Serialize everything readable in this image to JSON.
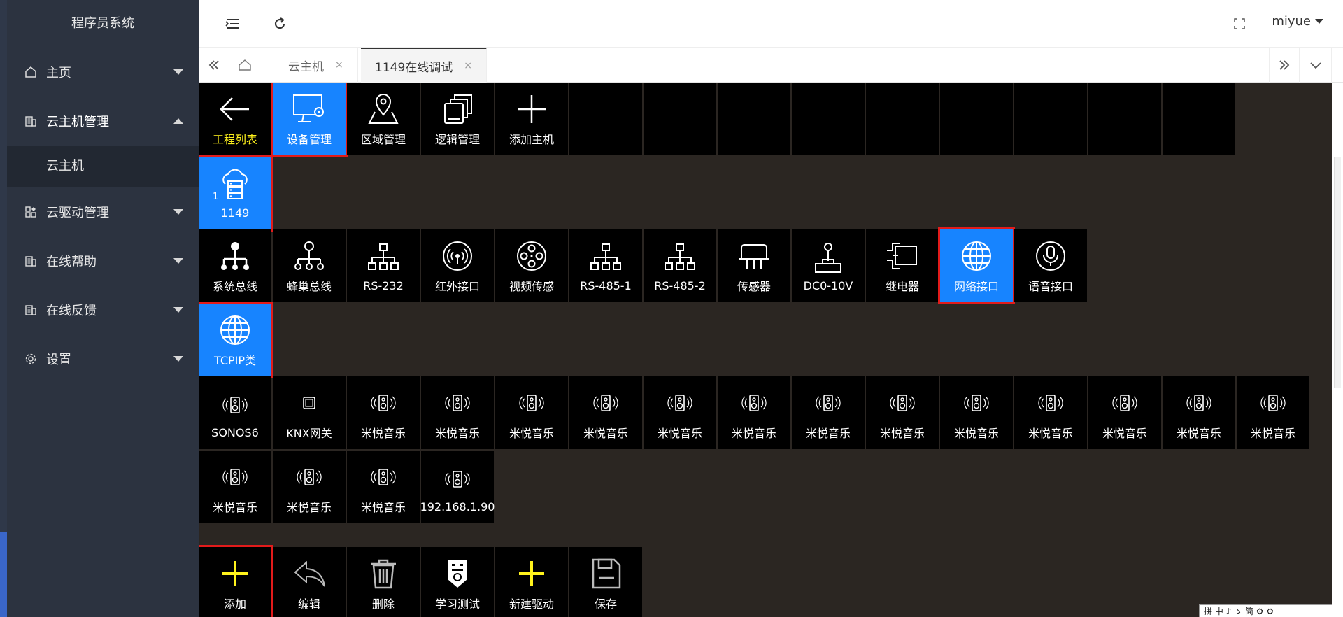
{
  "app": {
    "title": "程序员系统"
  },
  "sidebar": {
    "items": [
      {
        "label": "主页",
        "icon": "home-icon",
        "arrow": "down"
      },
      {
        "label": "云主机管理",
        "icon": "building-icon",
        "arrow": "up",
        "children": [
          {
            "label": "云主机"
          }
        ]
      },
      {
        "label": "云驱动管理",
        "icon": "apps-icon",
        "arrow": "down"
      },
      {
        "label": "在线帮助",
        "icon": "building-icon",
        "arrow": "down"
      },
      {
        "label": "在线反馈",
        "icon": "building-icon",
        "arrow": "down"
      },
      {
        "label": "设置",
        "icon": "gear-icon",
        "arrow": "down"
      }
    ]
  },
  "header": {
    "user": "miyue"
  },
  "tabs": [
    {
      "label": "云主机",
      "close": "×"
    },
    {
      "label": "1149在线调试",
      "close": "×"
    }
  ],
  "toolbar": [
    {
      "label": "工程列表",
      "icon": "arrow-left-icon"
    },
    {
      "label": "设备管理",
      "icon": "monitor-gear-icon"
    },
    {
      "label": "区域管理",
      "icon": "map-pin-icon"
    },
    {
      "label": "逻辑管理",
      "icon": "copy-icon"
    },
    {
      "label": "添加主机",
      "icon": "plus-icon"
    }
  ],
  "host": {
    "label": "1149",
    "index": "1"
  },
  "interfaces": [
    {
      "label": "系统总线",
      "icon": "bus-icon"
    },
    {
      "label": "蜂巢总线",
      "icon": "network-tree-icon"
    },
    {
      "label": "RS-232",
      "icon": "hierarchy-icon"
    },
    {
      "label": "红外接口",
      "icon": "infrared-icon"
    },
    {
      "label": "视频传感",
      "icon": "film-reel-icon"
    },
    {
      "label": "RS-485-1",
      "icon": "hierarchy-icon"
    },
    {
      "label": "RS-485-2",
      "icon": "hierarchy-icon"
    },
    {
      "label": "传感器",
      "icon": "sensor-icon"
    },
    {
      "label": "DC0-10V",
      "icon": "joystick-icon"
    },
    {
      "label": "继电器",
      "icon": "relay-icon"
    },
    {
      "label": "网络接口",
      "icon": "globe-icon"
    },
    {
      "label": "语音接口",
      "icon": "microphone-icon"
    }
  ],
  "category": {
    "label": "TCPIP类",
    "icon": "globe-icon"
  },
  "devices": [
    {
      "label": "SONOS6",
      "icon": "speaker-icon"
    },
    {
      "label": "KNX网关",
      "icon": "square-icon"
    },
    {
      "label": "米悦音乐",
      "icon": "speaker-icon"
    },
    {
      "label": "米悦音乐",
      "icon": "speaker-icon"
    },
    {
      "label": "米悦音乐",
      "icon": "speaker-icon"
    },
    {
      "label": "米悦音乐",
      "icon": "speaker-icon"
    },
    {
      "label": "米悦音乐",
      "icon": "speaker-icon"
    },
    {
      "label": "米悦音乐",
      "icon": "speaker-icon"
    },
    {
      "label": "米悦音乐",
      "icon": "speaker-icon"
    },
    {
      "label": "米悦音乐",
      "icon": "speaker-icon"
    },
    {
      "label": "米悦音乐",
      "icon": "speaker-icon"
    },
    {
      "label": "米悦音乐",
      "icon": "speaker-icon"
    },
    {
      "label": "米悦音乐",
      "icon": "speaker-icon"
    },
    {
      "label": "米悦音乐",
      "icon": "speaker-icon"
    },
    {
      "label": "米悦音乐",
      "icon": "speaker-icon"
    },
    {
      "label": "米悦音乐",
      "icon": "speaker-icon"
    },
    {
      "label": "米悦音乐",
      "icon": "speaker-icon"
    },
    {
      "label": "米悦音乐",
      "icon": "speaker-icon"
    },
    {
      "label": "192.168.1.90",
      "icon": "speaker-icon"
    }
  ],
  "actions": [
    {
      "label": "添加",
      "icon": "plus-icon"
    },
    {
      "label": "编辑",
      "icon": "reply-icon"
    },
    {
      "label": "删除",
      "icon": "trash-icon"
    },
    {
      "label": "学习测试",
      "icon": "remote-icon"
    },
    {
      "label": "新建驱动",
      "icon": "plus-icon"
    },
    {
      "label": "保存",
      "icon": "save-icon"
    }
  ],
  "taskbar_text": "拼 中 ♪ ゝ 简 ⚙ ⚙",
  "colors": {
    "selected_blue": "#1784ff",
    "highlight_red": "#e21b1b",
    "yellow": "#fff21c",
    "sidebar_bg": "#2c3340",
    "workspace_bg": "#2b2622"
  }
}
